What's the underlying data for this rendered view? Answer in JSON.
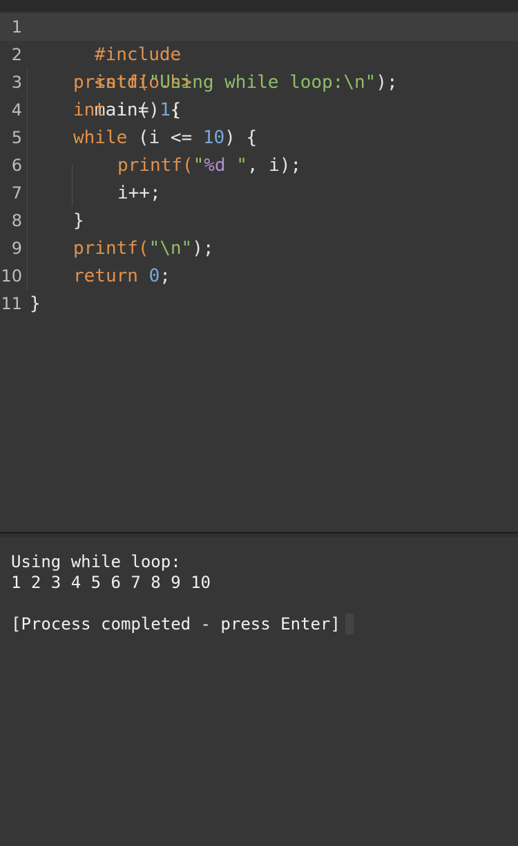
{
  "editor": {
    "lines": [
      {
        "num": "1",
        "tokens": [
          "#include",
          "<stdio.h>"
        ]
      },
      {
        "num": "2",
        "tokens": [
          "int",
          "main() {"
        ]
      },
      {
        "num": "3",
        "tokens": [
          "printf(",
          "\"Using while loop:\\n\"",
          ");"
        ]
      },
      {
        "num": "4",
        "tokens": [
          "int",
          " i = ",
          "1",
          ";"
        ]
      },
      {
        "num": "5",
        "tokens": [
          "while",
          " (i <= ",
          "10",
          ") {"
        ]
      },
      {
        "num": "6",
        "tokens": [
          "printf(",
          "\"",
          "%d",
          " \"",
          ", i);"
        ]
      },
      {
        "num": "7",
        "tokens": [
          "i++;"
        ]
      },
      {
        "num": "8",
        "tokens": [
          "}"
        ]
      },
      {
        "num": "9",
        "tokens": [
          "printf(",
          "\"\\n\"",
          ");"
        ]
      },
      {
        "num": "10",
        "tokens": [
          "return",
          " ",
          "0",
          ";"
        ]
      },
      {
        "num": "11",
        "tokens": [
          "}"
        ]
      }
    ]
  },
  "terminal": {
    "output_line_1": "Using while loop:",
    "output_line_2": "1 2 3 4 5 6 7 8 9 10",
    "status": "[Process completed - press Enter]"
  },
  "colors": {
    "background": "#363636",
    "keyword": "#e0924e",
    "string": "#8fbf6a",
    "number": "#7aa8d6",
    "format_specifier": "#b48ecf",
    "text": "#e6e6e6"
  }
}
